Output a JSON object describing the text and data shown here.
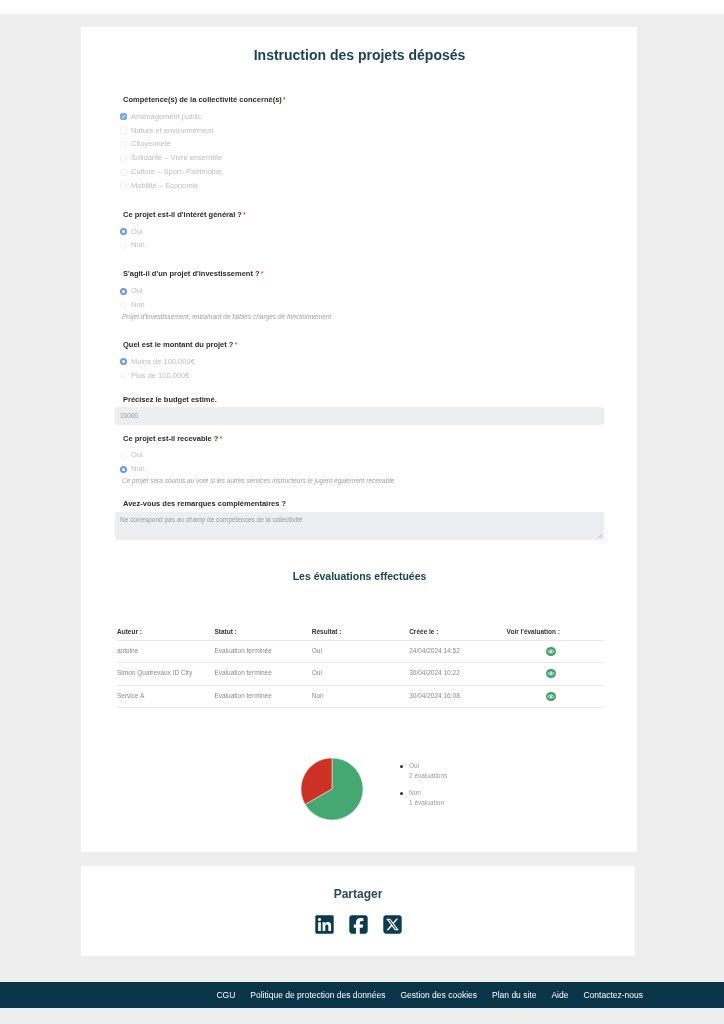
{
  "page_title": "Instruction des projets déposés",
  "questions": [
    {
      "kind": "checkbox",
      "label": "Compétence(s) de la collectivité concerné(s)",
      "required_mark": "*",
      "options": [
        {
          "label": "Aménagement public",
          "checked": true
        },
        {
          "label": "Nature et environnement",
          "checked": false
        },
        {
          "label": "Citoyenneté",
          "checked": false
        },
        {
          "label": "Solidarité – Vivre ensemble",
          "checked": false
        },
        {
          "label": "Culture – Sport- Patrimoine",
          "checked": false
        },
        {
          "label": "Mobilité – Economie",
          "checked": false
        }
      ]
    },
    {
      "kind": "radio",
      "label": "Ce projet est-il d'intérêt général ?",
      "required_mark": "*",
      "options": [
        {
          "label": "Oui",
          "selected": true
        },
        {
          "label": "Non",
          "selected": false
        }
      ]
    },
    {
      "kind": "radio",
      "label": "S'agit-il d'un projet d'investissement ?",
      "required_mark": "*",
      "options": [
        {
          "label": "Oui",
          "selected": true
        },
        {
          "label": "Non",
          "selected": false
        }
      ],
      "hint": "Projet d'investissement, entraînant de faibles charges de fonctionnement"
    },
    {
      "kind": "radio",
      "label": "Quel est le montant du projet ?",
      "required_mark": "*",
      "options": [
        {
          "label": "Moins de 100.000€",
          "selected": true
        },
        {
          "label": "Plus de 100.000€",
          "selected": false
        }
      ]
    },
    {
      "kind": "text",
      "label": "Précisez le budget estimé.",
      "value": "10000"
    },
    {
      "kind": "radio",
      "label": "Ce projet est-il recevable ?",
      "required_mark": "*",
      "options": [
        {
          "label": "Oui",
          "selected": false
        },
        {
          "label": "Non",
          "selected": true
        }
      ],
      "hint": "Ce projet sera soumis au vote si les autres services instructeurs le jugent également recevable"
    },
    {
      "kind": "textarea",
      "label": "Avez-vous des remarques complémentaires ?",
      "value": "Ne correspond pas au champ de compétences de la collectivité"
    }
  ],
  "evaluations": {
    "title": "Les évaluations effectuées",
    "columns": [
      "Auteur :",
      "Statut :",
      "Résultat :",
      "Créée le :",
      "Voir l'évaluation :"
    ],
    "rows": [
      {
        "author": "antoine",
        "status": "Evaluation terminée",
        "result": "Oui",
        "created": "24/04/2024 14:52"
      },
      {
        "author": "Simon Quatrevaux ID City",
        "status": "Evaluation terminée",
        "result": "Oui",
        "created": "30/04/2024 10:22"
      },
      {
        "author": "Service A",
        "status": "Evaluation terminée",
        "result": "Non",
        "created": "30/04/2024 16:08"
      }
    ]
  },
  "results_chart": {
    "chart_data": {
      "type": "pie",
      "categories": [
        "Oui",
        "Non"
      ],
      "values": [
        66.7,
        33.3
      ],
      "colors": [
        "#45a872",
        "#cc3126"
      ]
    },
    "legend_counts": [
      "2 évaluations",
      "1 évaluation"
    ]
  },
  "share": {
    "title": "Partager",
    "networks": [
      {
        "kind": "linkedin"
      },
      {
        "kind": "facebook"
      },
      {
        "kind": "x"
      }
    ]
  },
  "footer": {
    "links": [
      "CGU",
      "Politique de protection des données",
      "Gestion des cookies",
      "Plan du site",
      "Aide",
      "Contactez-nous"
    ]
  }
}
